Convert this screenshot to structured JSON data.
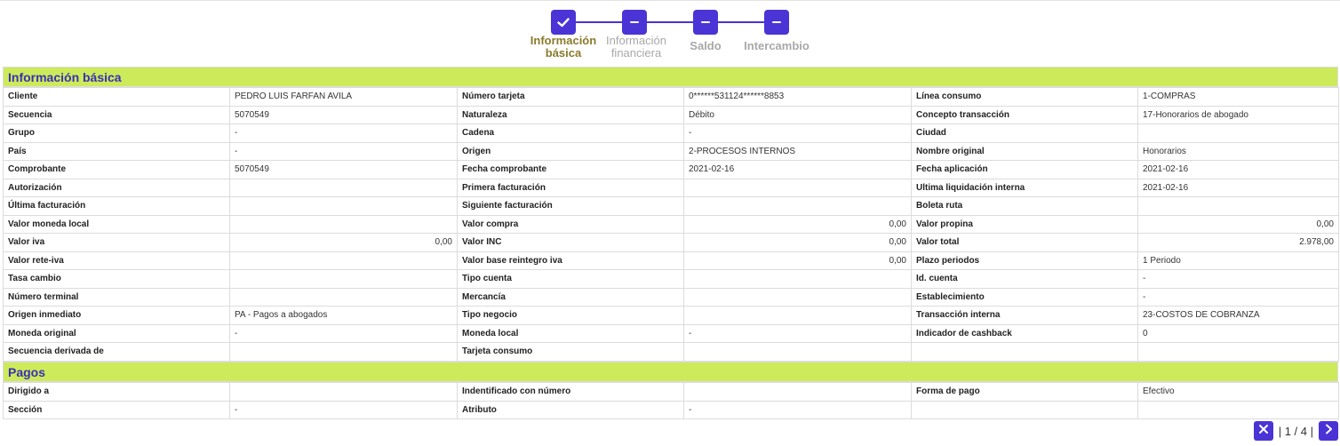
{
  "stepper": {
    "steps": [
      {
        "label_line1": "Información",
        "label_line2": "básica",
        "state": "done"
      },
      {
        "label_line1": "Información",
        "label_line2": "financiera",
        "state": "pending"
      },
      {
        "label_line1": "Saldo",
        "label_line2": "",
        "state": "pending"
      },
      {
        "label_line1": "Intercambio",
        "label_line2": "",
        "state": "pending"
      }
    ]
  },
  "colors": {
    "accent": "#4a34d6",
    "section_header_bg": "#cdea5a",
    "section_header_text": "#3a2fb8",
    "active_step_text": "#8a7a2c"
  },
  "basic_info": {
    "title": "Información básica",
    "rows": [
      [
        "Cliente",
        "PEDRO LUIS FARFAN AVILA",
        "Número tarjeta",
        "0******531124******8853",
        "Línea consumo",
        "1-COMPRAS"
      ],
      [
        "Secuencia",
        "5070549",
        "Naturaleza",
        "Débito",
        "Concepto transacción",
        "17-Honorarios de abogado"
      ],
      [
        "Grupo",
        "-",
        "Cadena",
        "-",
        "Ciudad",
        ""
      ],
      [
        "País",
        "-",
        "Origen",
        "2-PROCESOS INTERNOS",
        "Nombre original",
        "Honorarios"
      ],
      [
        "Comprobante",
        "5070549",
        "Fecha comprobante",
        "2021-02-16",
        "Fecha aplicación",
        "2021-02-16"
      ],
      [
        "Autorización",
        "",
        "Primera facturación",
        "",
        "Ultima liquidación interna",
        "2021-02-16"
      ],
      [
        "Última facturación",
        "",
        "Siguiente facturación",
        "",
        "Boleta ruta",
        ""
      ],
      [
        "Valor moneda local",
        "",
        "Valor compra",
        "0,00",
        "Valor propina",
        "0,00"
      ],
      [
        "Valor iva",
        "0,00",
        "Valor INC",
        "0,00",
        "Valor total",
        "2.978,00"
      ],
      [
        "Valor rete-iva",
        "",
        "Valor base reintegro iva",
        "0,00",
        "Plazo periodos",
        "1 Periodo"
      ],
      [
        "Tasa cambio",
        "",
        "Tipo cuenta",
        "",
        "Id. cuenta",
        "-"
      ],
      [
        "Número terminal",
        "",
        "Mercancía",
        "",
        "Establecimiento",
        "-"
      ],
      [
        "Origen inmediato",
        "PA - Pagos a abogados",
        "Tipo negocio",
        "",
        "Transacción interna",
        "23-COSTOS DE COBRANZA"
      ],
      [
        "Moneda original",
        "-",
        "Moneda local",
        "-",
        "Indicador de cashback",
        "0"
      ],
      [
        "Secuencia derivada de",
        "",
        "Tarjeta consumo",
        "",
        "",
        ""
      ]
    ]
  },
  "payments": {
    "title": "Pagos",
    "rows": [
      [
        "Dirigido a",
        "",
        "Indentificado con número",
        "",
        "Forma de pago",
        "Efectivo"
      ],
      [
        "Sección",
        "-",
        "Atributo",
        "-",
        "",
        ""
      ]
    ]
  },
  "pager": {
    "text": "| 1 / 4 |",
    "close_icon": "close-icon",
    "next_icon": "chevron-right-icon"
  }
}
